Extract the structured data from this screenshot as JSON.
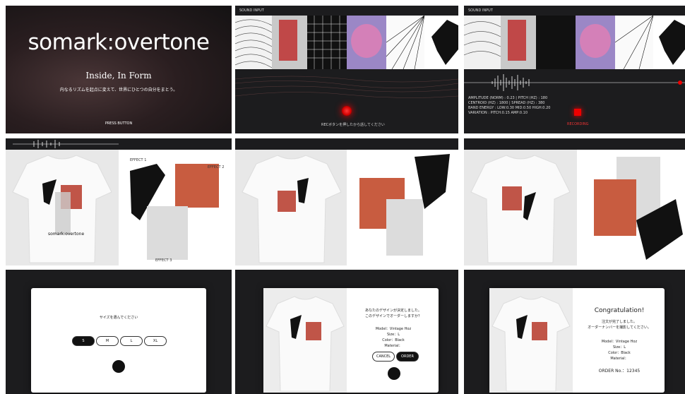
{
  "title_screen": {
    "logo": "somark:overtone",
    "tagline": "Inside, In Form",
    "subtitle": "内なるリズムを起点に変えて、世界にひとつの自分をまとう。",
    "press_button": "PRESS BUTTON"
  },
  "input_screen": {
    "label": "SOUND INPUT",
    "instruction": "RECボタンを押したから話してください",
    "recording": "RECORDING",
    "metrics": [
      "AMPLITUDE (NORM) : 0.23 | PITCH (HZ) : 180",
      "CENTROID (HZ) : 1800 | SPREAD (HZ) : 380",
      "BAND ENERGY : LOW:0.30 MID:0.50 HIGH:0.20",
      "VARIATION : PITCH:0.15 AMP:0.10"
    ]
  },
  "design_screen": {
    "effects": [
      "EFFECT 1",
      "EFFECT 2",
      "EFFECT 3"
    ],
    "shirt_logo": "somark:overtone"
  },
  "size_modal": {
    "prompt": "サイズを選んでください",
    "sizes": [
      "S",
      "M",
      "L",
      "XL"
    ]
  },
  "confirm_modal": {
    "line1": "あなたのデザインが決定しました。",
    "line2": "このデザインでオーダーしますか？",
    "model": "Model：Vintage Hoz",
    "size": "Size：L",
    "color": "Color：Black",
    "material": "Material：",
    "cancel": "CANCEL",
    "order": "ORDER"
  },
  "done_modal": {
    "heading": "Congratulation!",
    "line1": "注文が完了しました。",
    "line2": "オーダーナンバーを撮影してください。",
    "model": "Model：Vintage Hoz",
    "size": "Size：L",
    "color": "Color：Black",
    "material": "Material：",
    "order_no": "ORDER No.：12345"
  }
}
